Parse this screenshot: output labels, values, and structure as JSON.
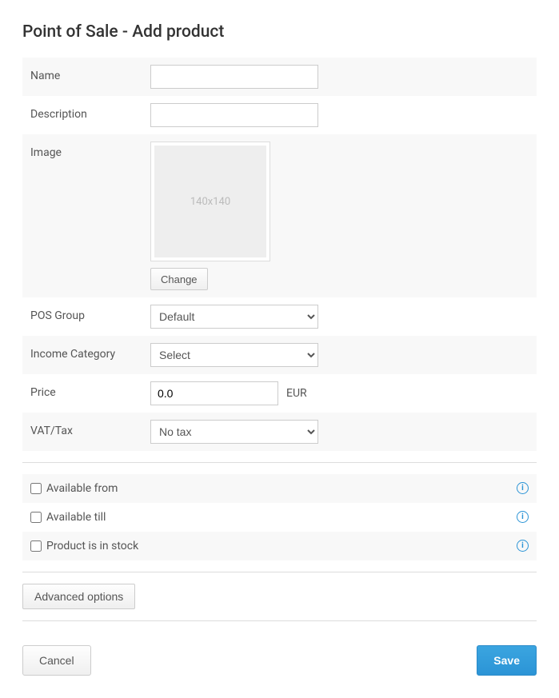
{
  "title": "Point of Sale - Add product",
  "fields": {
    "name": {
      "label": "Name",
      "value": ""
    },
    "description": {
      "label": "Description",
      "value": ""
    },
    "image": {
      "label": "Image",
      "placeholder": "140x140",
      "change_btn": "Change"
    },
    "pos_group": {
      "label": "POS Group",
      "selected": "Default"
    },
    "income_category": {
      "label": "Income Category",
      "selected": "Select"
    },
    "price": {
      "label": "Price",
      "value": "0.0",
      "currency": "EUR"
    },
    "vat": {
      "label": "VAT/Tax",
      "selected": "No tax"
    }
  },
  "checkboxes": {
    "available_from": {
      "label": "Available from",
      "checked": false
    },
    "available_till": {
      "label": "Available till",
      "checked": false
    },
    "in_stock": {
      "label": "Product is in stock",
      "checked": false
    }
  },
  "advanced_btn": "Advanced options",
  "footer": {
    "cancel": "Cancel",
    "save": "Save"
  }
}
